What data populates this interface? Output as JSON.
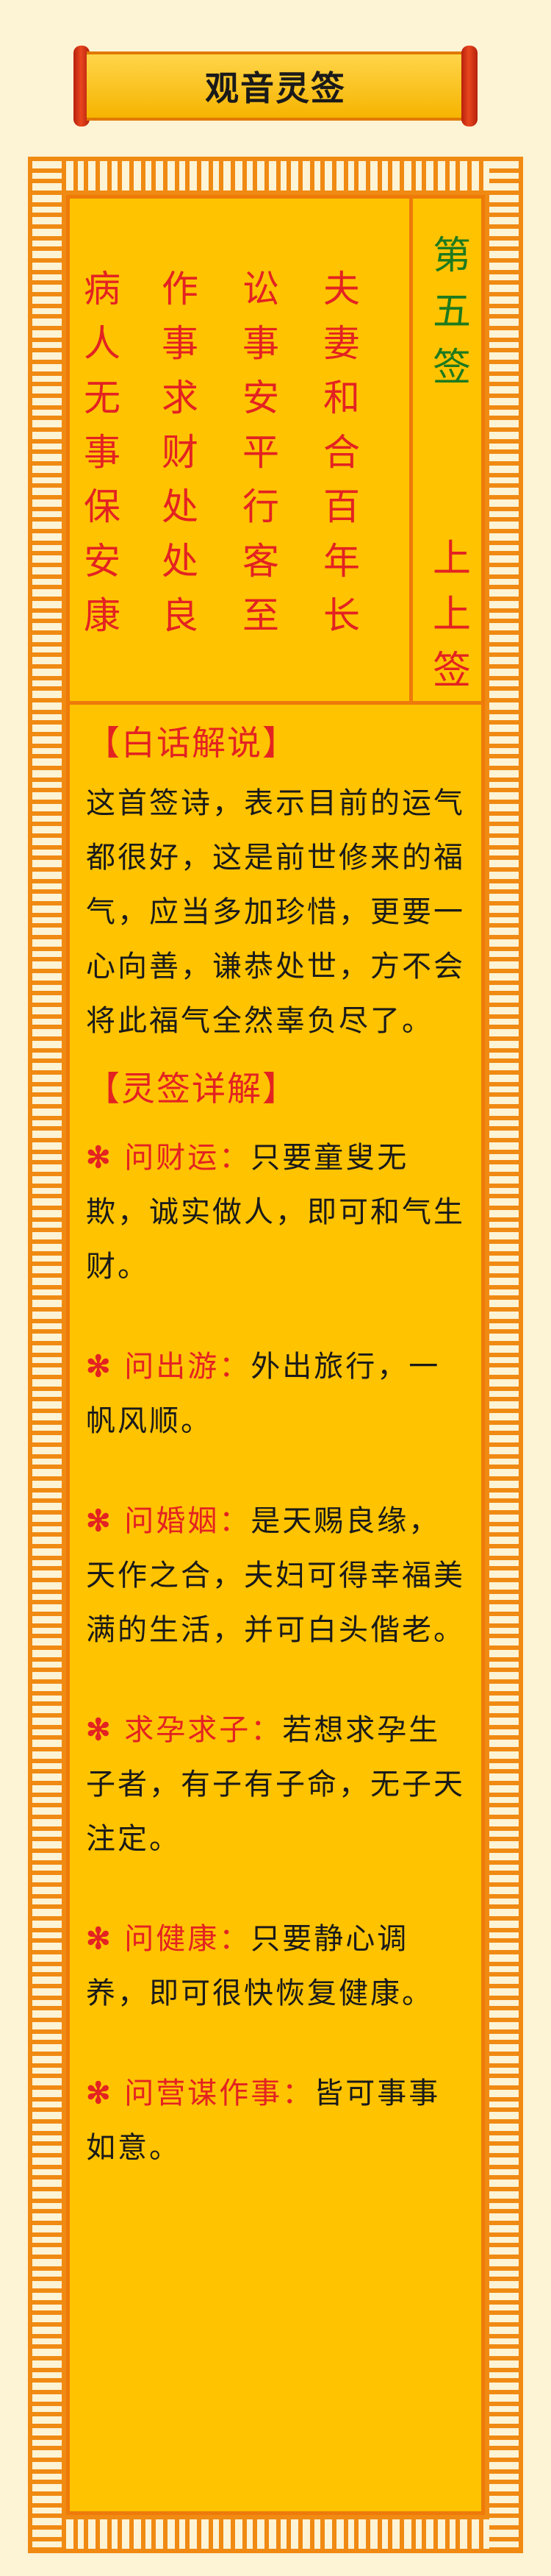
{
  "title": "观音灵签",
  "poem": {
    "columns": [
      [
        "夫",
        "妻",
        "和",
        "合",
        "百",
        "年",
        "长"
      ],
      [
        "讼",
        "事",
        "安",
        "平",
        "行",
        "客",
        "至"
      ],
      [
        "作",
        "事",
        "求",
        "财",
        "处",
        "处",
        "良"
      ],
      [
        "病",
        "人",
        "无",
        "事",
        "保",
        "安",
        "康"
      ]
    ],
    "sign_number": "第五签",
    "sign_grade": "上上签"
  },
  "explanation": {
    "heading": "【白话解说】",
    "text": "这首签诗，表示目前的运气都很好，这是前世修来的福气，应当多加珍惜，更要一心向善，谦恭处世，方不会将此福气全然辜负尽了。"
  },
  "details": {
    "heading": "【灵签详解】",
    "bullet": "✻",
    "items": [
      {
        "label": "问财运：",
        "text": "只要童叟无欺，诚实做人，即可和气生财。"
      },
      {
        "label": "问出游：",
        "text": "外出旅行，一帆风顺。"
      },
      {
        "label": "问婚姻：",
        "text": "是天赐良缘，天作之合，夫妇可得幸福美满的生活，并可白头偕老。"
      },
      {
        "label": "求孕求子：",
        "text": "若想求孕生子者，有子有子命，无子天注定。"
      },
      {
        "label": "问健康：",
        "text": "只要静心调养，即可很快恢复健康。"
      },
      {
        "label": "问营谋作事：",
        "text": "皆可事事如意。"
      }
    ]
  },
  "colors": {
    "red": "#e32222",
    "green": "#1e7a1e",
    "gold": "#ffc300",
    "orange": "#f08a12"
  }
}
